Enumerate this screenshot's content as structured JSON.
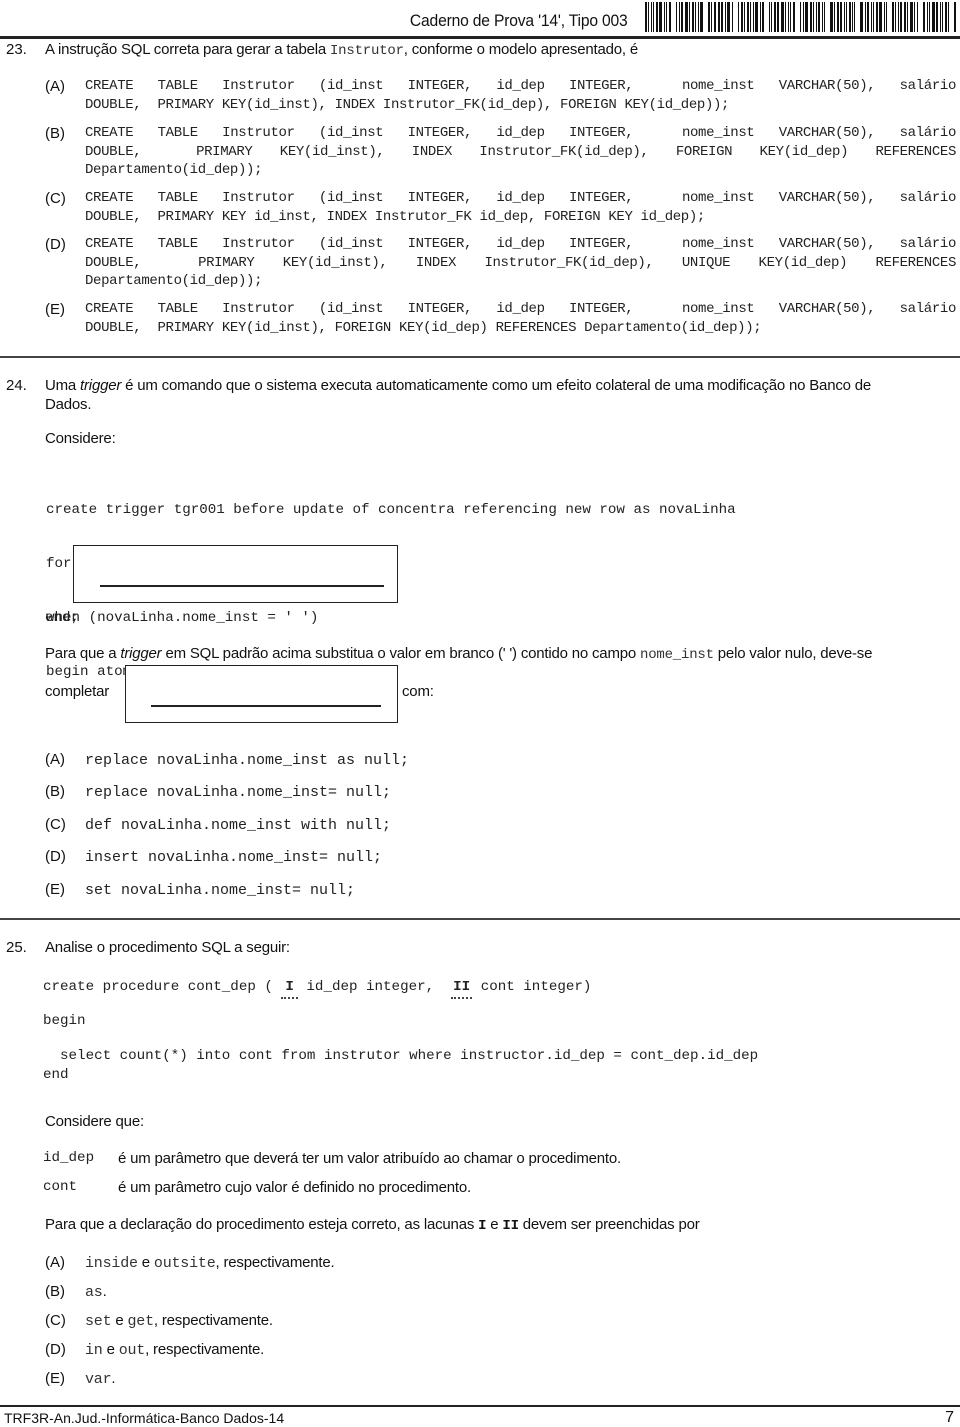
{
  "header": {
    "title": "Caderno de Prova '14', Tipo 003",
    "barcode": "barcode"
  },
  "q23": {
    "number": "23.",
    "prompt_before": "A instrução SQL correta para gerar a tabela ",
    "prompt_code": "Instrutor",
    "prompt_after": ", conforme o modelo apresentado, é",
    "options": [
      {
        "letter": "(A)",
        "lines": [
          "CREATE TABLE Instrutor (id_inst INTEGER, id_dep INTEGER,  nome_inst VARCHAR(50), salário",
          "DOUBLE,  PRIMARY KEY(id_inst), INDEX Instrutor_FK(id_dep), FOREIGN KEY(id_dep));"
        ]
      },
      {
        "letter": "(B)",
        "lines": [
          "CREATE TABLE Instrutor (id_inst INTEGER, id_dep INTEGER,  nome_inst VARCHAR(50), salário",
          "DOUBLE,  PRIMARY KEY(id_inst), INDEX Instrutor_FK(id_dep), FOREIGN KEY(id_dep) REFERENCES",
          "Departamento(id_dep));"
        ]
      },
      {
        "letter": "(C)",
        "lines": [
          "CREATE TABLE Instrutor (id_inst INTEGER, id_dep INTEGER,  nome_inst VARCHAR(50), salário",
          "DOUBLE,  PRIMARY KEY id_inst, INDEX Instrutor_FK id_dep, FOREIGN KEY id_dep);"
        ]
      },
      {
        "letter": "(D)",
        "lines": [
          "CREATE TABLE Instrutor (id_inst INTEGER, id_dep INTEGER,  nome_inst VARCHAR(50), salário",
          "DOUBLE,  PRIMARY KEY(id_inst), INDEX Instrutor_FK(id_dep), UNIQUE KEY(id_dep) REFERENCES",
          "Departamento(id_dep));"
        ]
      },
      {
        "letter": "(E)",
        "lines": [
          "CREATE TABLE Instrutor (id_inst INTEGER, id_dep INTEGER,  nome_inst VARCHAR(50), salário",
          "DOUBLE,  PRIMARY KEY(id_inst), FOREIGN KEY(id_dep) REFERENCES Departamento(id_dep));"
        ]
      }
    ]
  },
  "q24": {
    "number": "24.",
    "intro_before": "Uma ",
    "intro_italic": "trigger",
    "intro_after": " é um comando que o sistema executa automaticamente como um efeito colateral de uma modificação no Banco de",
    "intro_line2": "Dados.",
    "considere": "Considere:",
    "code": [
      "create trigger tgr001 before update of concentra referencing new row as novaLinha",
      "for each row",
      "when (novaLinha.nome_inst = ' ')",
      "begin atomic"
    ],
    "code_end": "end;",
    "para_before": "Para que a ",
    "para_italic": "trigger",
    "para_mid": " em SQL padrão acima substitua o valor em branco (' ') contido no campo ",
    "para_code": "nome_inst",
    "para_after": " pelo valor nulo, deve-se",
    "completar": "completar",
    "com": "com:",
    "options": [
      {
        "letter": "(A)",
        "code": "replace novaLinha.nome_inst as null;"
      },
      {
        "letter": "(B)",
        "code": "replace novaLinha.nome_inst= null;"
      },
      {
        "letter": "(C)",
        "code": "def novaLinha.nome_inst with null;"
      },
      {
        "letter": "(D)",
        "code": "insert novaLinha.nome_inst= null;"
      },
      {
        "letter": "(E)",
        "code": "set novaLinha.nome_inst= null;"
      }
    ]
  },
  "q25": {
    "number": "25.",
    "prompt": "Analise o procedimento SQL a seguir:",
    "code_l1_a": "create procedure cont_dep (",
    "blank_i": "I",
    "code_l1_b": " id_dep integer, ",
    "blank_ii": "II",
    "code_l1_c": " cont integer)",
    "code_begin": "begin",
    "code_select": "  select count(*) into cont from instrutor where instructor.id_dep = cont_dep.id_dep",
    "code_end": "end",
    "considere": "Considere que:",
    "defs": [
      {
        "term": "id_dep",
        "desc": "é um parâmetro que deverá ter um valor atribuído ao chamar o procedimento."
      },
      {
        "term": "cont",
        "desc": "é um parâmetro cujo valor é definido no procedimento."
      }
    ],
    "para_before": "Para que a declaração do procedimento esteja correto, as lacunas ",
    "para_i": "I",
    "para_e": " e ",
    "para_ii": "II",
    "para_after": " devem ser preenchidas por",
    "options": [
      {
        "letter": "(A)",
        "c1": "inside",
        "mid": " e ",
        "c2": "outsite",
        "tail": ", respectivamente."
      },
      {
        "letter": "(B)",
        "c1": "as",
        "mid": "",
        "c2": "",
        "tail": "."
      },
      {
        "letter": "(C)",
        "c1": "set",
        "mid": " e ",
        "c2": "get",
        "tail": ", respectivamente."
      },
      {
        "letter": "(D)",
        "c1": "in",
        "mid": " e ",
        "c2": "out",
        "tail": ", respectivamente."
      },
      {
        "letter": "(E)",
        "c1": "var",
        "mid": "",
        "c2": "",
        "tail": "."
      }
    ]
  },
  "footer": {
    "text": "TRF3R-An.Jud.-Informática-Banco Dados-14",
    "page": "7"
  }
}
